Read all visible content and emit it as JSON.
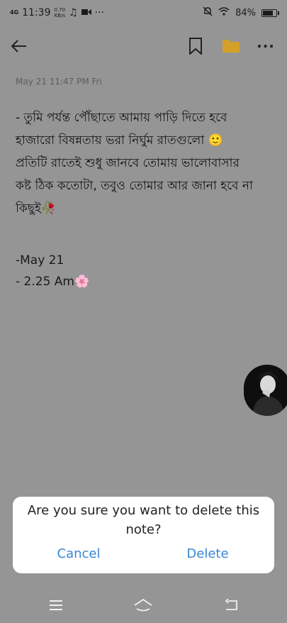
{
  "status_bar": {
    "network_type": "4G",
    "time": "11:39",
    "speed_value": "0.70",
    "speed_unit": "KB/s",
    "more": "···",
    "battery_percent": "84%",
    "battery_level": 0.84
  },
  "toolbar": {
    "back_icon": "arrow-left-icon",
    "bookmark_icon": "bookmark-icon",
    "folder_icon": "folder-icon",
    "more_label": "···",
    "folder_color": "#d4a02a"
  },
  "note": {
    "date": "May 21 11:47 PM Fri",
    "lines": [
      "- তুমি পর্যন্ত পৌঁছাতে আমায় পাড়ি দিতে হবে",
      "হাজারো বিষন্নতায় ভরা নির্ঘুম রাতগুলো 🙂",
      "প্রতিটি রাতেই শুধু জানবে তোমায় ভালোবাসার",
      " কষ্ট ঠিক কতোটা, তবুও তোমার আর জানা হবে না",
      "কিছুই🥀"
    ],
    "footer_date": "-May  21",
    "footer_time": "- 2.25 Am🌸"
  },
  "dialog": {
    "message": "Are you sure you want to delete this note?",
    "cancel_label": "Cancel",
    "delete_label": "Delete",
    "accent_color": "#3a86d8"
  },
  "nav_bar": {
    "menu_icon": "menu-icon",
    "home_icon": "home-icon",
    "back_icon": "back-icon"
  }
}
